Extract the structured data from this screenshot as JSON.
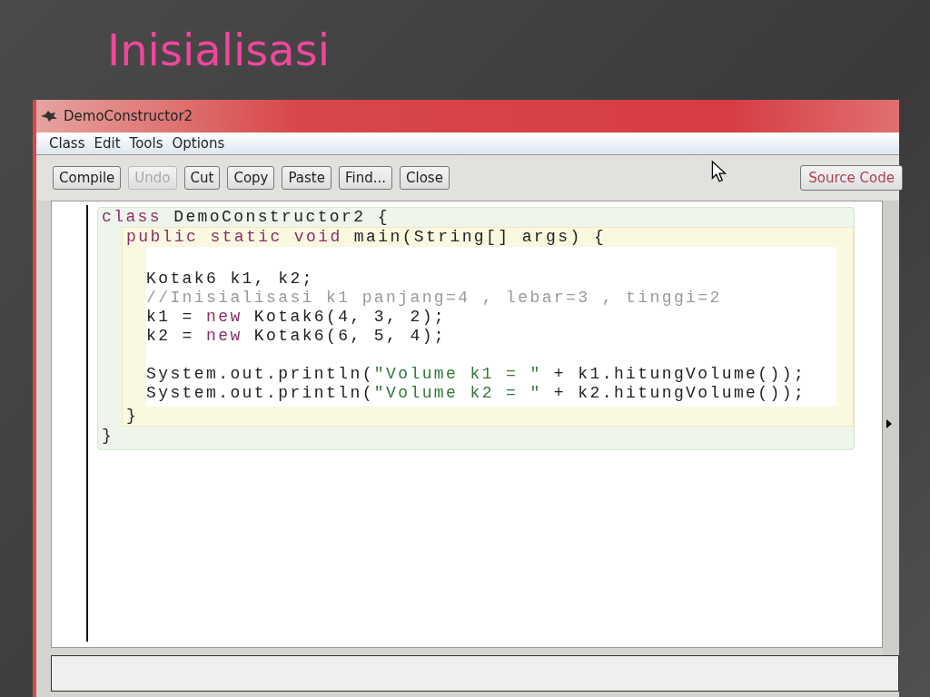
{
  "slide": {
    "title": "Inisialisasi"
  },
  "window": {
    "title": "DemoConstructor2"
  },
  "menu": [
    "Class",
    "Edit",
    "Tools",
    "Options"
  ],
  "toolbar": [
    {
      "label": "Compile",
      "disabled": false
    },
    {
      "label": "Undo",
      "disabled": true
    },
    {
      "label": "Cut",
      "disabled": false
    },
    {
      "label": "Copy",
      "disabled": false
    },
    {
      "label": "Paste",
      "disabled": false
    },
    {
      "label": "Find...",
      "disabled": false
    },
    {
      "label": "Close",
      "disabled": false
    }
  ],
  "view_selector": "Source Code",
  "editor": {
    "class_header": [
      {
        "kind": "keyword",
        "text": "class"
      },
      {
        "kind": "plain",
        "text": " DemoConstructor2 {"
      }
    ],
    "method_header": [
      {
        "kind": "keyword",
        "text": "public static void"
      },
      {
        "kind": "plain",
        "text": " main(String[] args) {"
      }
    ],
    "body_paragraphs": [
      [
        [
          {
            "kind": "plain",
            "text": "Kotak6 k1, k2;"
          }
        ],
        [
          {
            "kind": "comment",
            "text": "//Inisialisasi k1 panjang=4 , lebar=3 , tinggi=2"
          }
        ],
        [
          {
            "kind": "plain",
            "text": "k1 = "
          },
          {
            "kind": "keyword",
            "text": "new"
          },
          {
            "kind": "plain",
            "text": " Kotak6(4, 3, 2);"
          }
        ],
        [
          {
            "kind": "plain",
            "text": "k2 = "
          },
          {
            "kind": "keyword",
            "text": "new"
          },
          {
            "kind": "plain",
            "text": " Kotak6(6, 5, 4);"
          }
        ]
      ],
      [
        [
          {
            "kind": "plain",
            "text": "System.out.println("
          },
          {
            "kind": "string",
            "text": "\"Volume k1 = \""
          },
          {
            "kind": "plain",
            "text": " + k1.hitungVolume());"
          }
        ],
        [
          {
            "kind": "plain",
            "text": "System.out.println("
          },
          {
            "kind": "string",
            "text": "\"Volume k2 = \""
          },
          {
            "kind": "plain",
            "text": " + k2.hitungVolume());"
          }
        ]
      ]
    ],
    "method_close": "}",
    "class_close": "}"
  }
}
